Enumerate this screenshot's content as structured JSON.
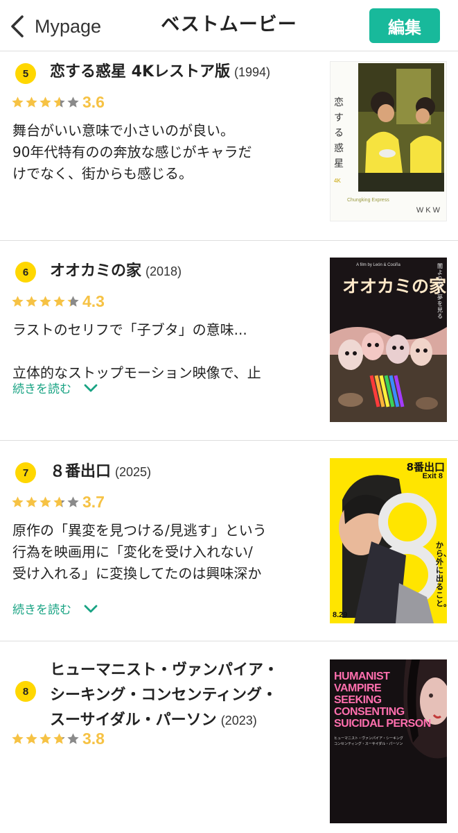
{
  "header": {
    "back_label": "Mypage",
    "title": "ベストムービー",
    "edit_label": "編集"
  },
  "colors": {
    "accent": "#18b99b",
    "rank_badge": "#ffd700",
    "star": "#f6c244",
    "star_empty": "#8a8a8a",
    "readmore": "#18a383"
  },
  "items": [
    {
      "rank": "5",
      "title": "恋する惑星 4Kレストア版",
      "year": "(1994)",
      "rating_value": 3.6,
      "score": "3.6",
      "review_lines": [
        "舞台がいい意味で小さいのが良い。",
        "90年代特有のの奔放な感じがキャラだ",
        "けでなく、街からも感じる。"
      ],
      "poster": {
        "vertical_title": "恋する惑星",
        "badge": "4K",
        "caption": "Chungking Express",
        "logo": "WKW"
      }
    },
    {
      "rank": "6",
      "title": "オオカミの家",
      "year": "(2018)",
      "rating_value": 4.3,
      "score": "4.3",
      "review_lines": [
        "ラストのセリフで「子ブタ」の意味...",
        "",
        "立体的なストップモーション映像で、止"
      ],
      "read_more": "続きを読む",
      "poster": {
        "byline": "A film by León & Cociña",
        "title": "オオカミの家",
        "side_text": "闇より深い　夢を見る"
      }
    },
    {
      "rank": "7",
      "title": "８番出口",
      "year": "(2025)",
      "rating_value": 3.7,
      "score": "3.7",
      "review_lines": [
        "原作の「異変を見つける/見逃す」という",
        "行為を映画用に「変化を受け入れない/",
        "受け入れる」に変換してたのは興味深か"
      ],
      "read_more": "続きを読む",
      "poster": {
        "title": "8番出口",
        "subtitle": "Exit 8",
        "tagline": "から、外に出ること。",
        "date": "8.29"
      }
    },
    {
      "rank": "8",
      "title": "ヒューマニスト・ヴァンパイア・シーキング・コンセンティング・スーサイダル・パーソン",
      "title_lines": [
        "ヒューマニスト・ヴァンパイア・",
        "シーキング・コンセンティング・",
        "スーサイダル・パーソン"
      ],
      "year": "(2023)",
      "rating_value": 3.8,
      "score": "3.8",
      "poster": {
        "lines": [
          "HUMANIST",
          "VAMPIRE",
          "SEEKING",
          "CONSENTING",
          "SUICIDAL PERSON"
        ],
        "jp_lines": [
          "ヒューマニスト・ヴァンパイア・シーキング",
          "コンセンティング・スーサイダル・パーソン"
        ]
      }
    }
  ]
}
